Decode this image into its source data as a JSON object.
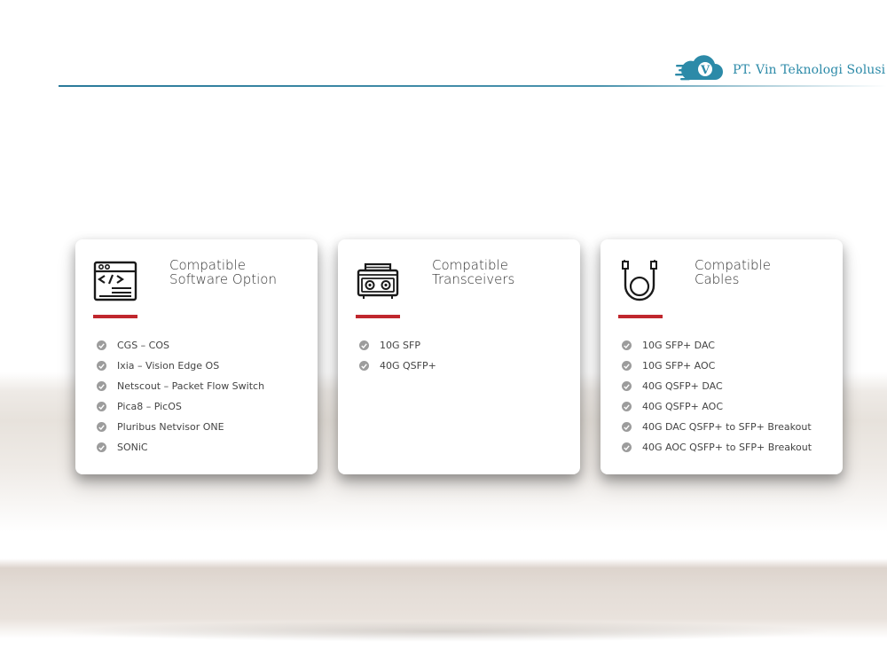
{
  "brand": {
    "name": "PT. Vin Teknologi Solusi",
    "logo_letter": "V",
    "color": "#2c8aa8"
  },
  "accent_color": "#c0272d",
  "cards": [
    {
      "icon": "code-window-icon",
      "title_line1": "Compatible",
      "title_line2": "Software Option",
      "items": [
        "CGS – COS",
        "Ixia – Vision Edge OS",
        "Netscout – Packet Flow Switch",
        "Pica8 – PicOS",
        "Pluribus Netvisor ONE",
        "SONiC"
      ]
    },
    {
      "icon": "transceiver-icon",
      "title_line1": "Compatible",
      "title_line2": "Transceivers",
      "items": [
        "10G SFP",
        "40G QSFP+"
      ]
    },
    {
      "icon": "cable-icon",
      "title_line1": "Compatible",
      "title_line2": "Cables",
      "items": [
        "10G SFP+ DAC",
        "10G SFP+ AOC",
        "40G QSFP+ DAC",
        "40G QSFP+ AOC",
        "40G DAC QSFP+ to SFP+ Breakout",
        "40G AOC QSFP+ to SFP+ Breakout"
      ]
    }
  ]
}
